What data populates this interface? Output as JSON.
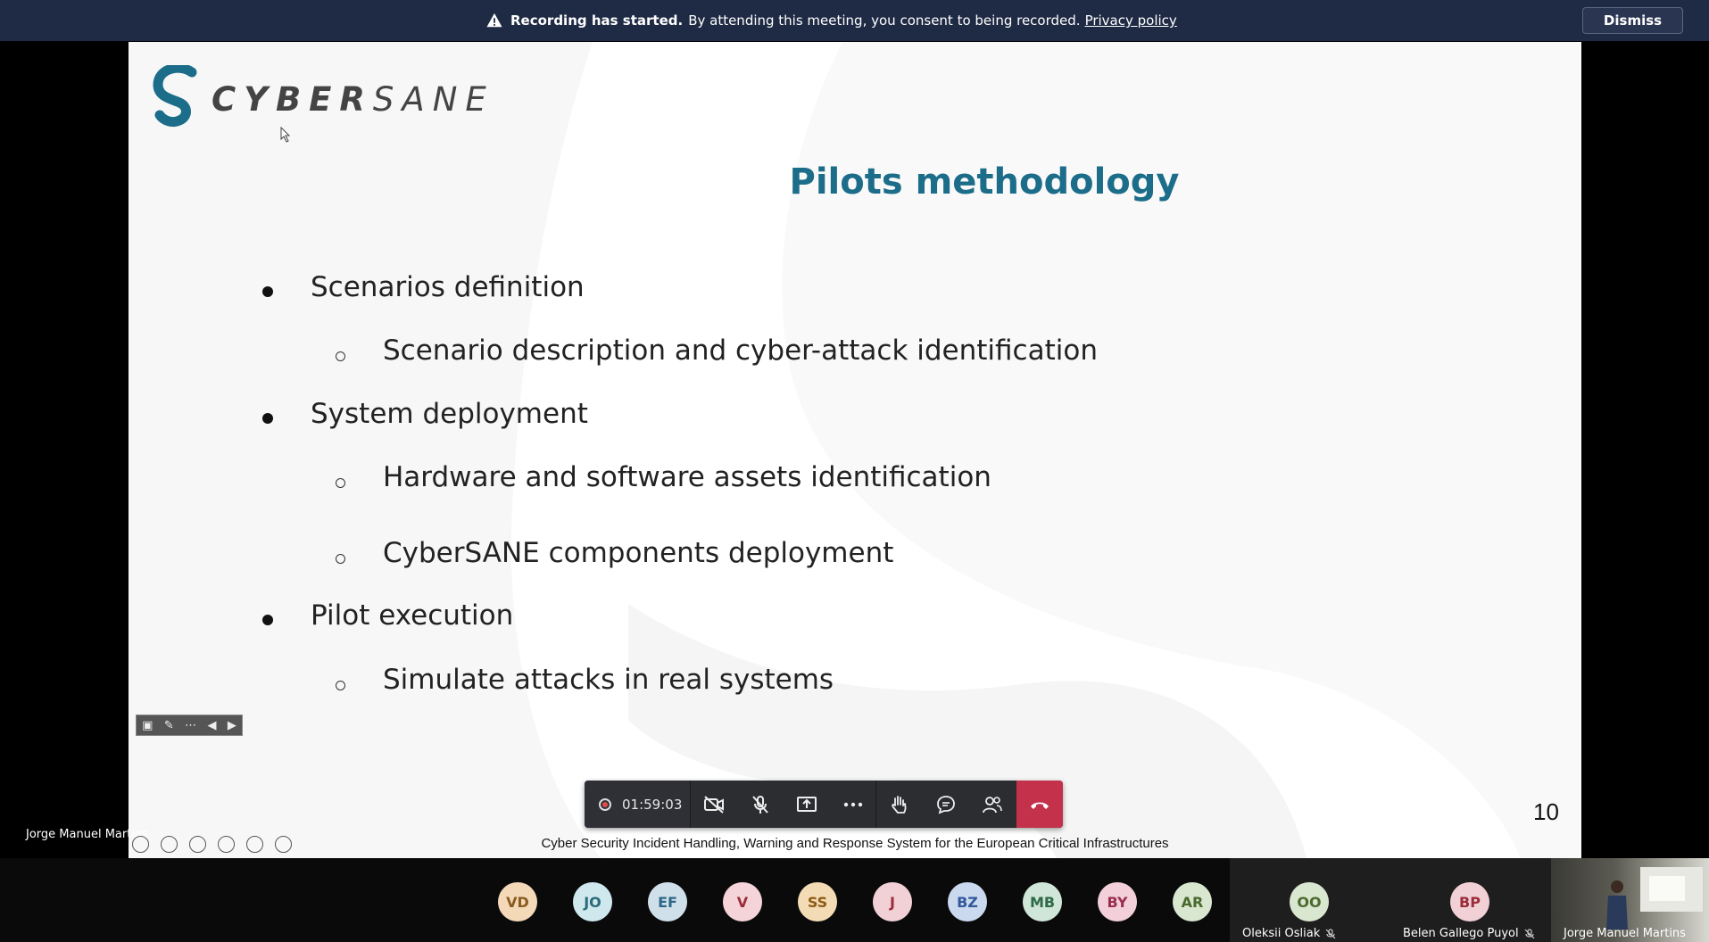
{
  "banner": {
    "bold": "Recording has started.",
    "text": "By attending this meeting, you consent to being recorded.",
    "link": "Privacy policy",
    "dismiss": "Dismiss"
  },
  "slide": {
    "logo_bold": "CYBER",
    "logo_light": "SANE",
    "title": "Pilots methodology",
    "bullets": [
      {
        "text": "Scenarios definition",
        "subs": [
          "Scenario description and cyber-attack identification"
        ]
      },
      {
        "text": "System deployment",
        "subs": [
          "Hardware and software assets identification",
          "CyberSANE components deployment"
        ]
      },
      {
        "text": "Pilot execution",
        "subs": [
          "Simulate attacks in real systems"
        ]
      }
    ],
    "page_number": "10",
    "footer": "Cyber Security Incident Handling, Warning and Response System for the European Critical Infrastructures",
    "colors": {
      "title": "#1b6d8a",
      "logo": "#1b6d8a"
    }
  },
  "speaker": {
    "name": "Jorge Manuel Martins"
  },
  "controls": {
    "timer": "01:59:03"
  },
  "participants": [
    {
      "initials": "VD",
      "bg": "#f3d9b8",
      "fg": "#8a5a1e"
    },
    {
      "initials": "JO",
      "bg": "#cfe8ee",
      "fg": "#2a6a7a"
    },
    {
      "initials": "EF",
      "bg": "#cfe0ea",
      "fg": "#2f6787"
    },
    {
      "initials": "V",
      "bg": "#f4d4d8",
      "fg": "#9a2d3a"
    },
    {
      "initials": "SS",
      "bg": "#f3dbb5",
      "fg": "#8c5a14"
    },
    {
      "initials": "J",
      "bg": "#f1d0d6",
      "fg": "#9a2d3a"
    },
    {
      "initials": "BZ",
      "bg": "#cbd9ef",
      "fg": "#33589a"
    },
    {
      "initials": "MB",
      "bg": "#cfe6d8",
      "fg": "#2d6a45"
    },
    {
      "initials": "BY",
      "bg": "#f2cfd9",
      "fg": "#9a2d50"
    },
    {
      "initials": "AR",
      "bg": "#d9e6d0",
      "fg": "#4a6a2d"
    }
  ],
  "tiles": [
    {
      "initials": "OO",
      "name": "Oleksii Osliak",
      "bg": "#d9e6d0",
      "fg": "#4a6a2d"
    },
    {
      "initials": "BP",
      "name": "Belen Gallego Puyol",
      "bg": "#f1d0d6",
      "fg": "#9a2d3a"
    },
    {
      "name": "Jorge Manuel Martins"
    }
  ]
}
